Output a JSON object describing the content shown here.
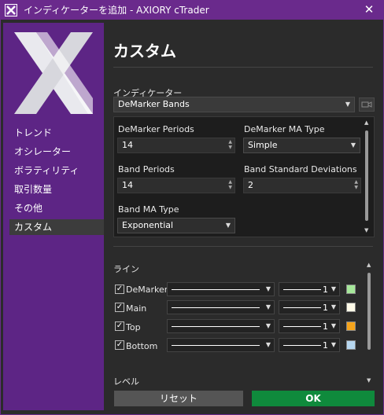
{
  "window": {
    "title": "インディケーターを追加 - AXIORY cTrader",
    "accent": "#5d2585"
  },
  "sidebar": {
    "items": [
      {
        "label": "トレンド",
        "active": false
      },
      {
        "label": "オシレーター",
        "active": false
      },
      {
        "label": "ボラティリティ",
        "active": false
      },
      {
        "label": "取引数量",
        "active": false
      },
      {
        "label": "その他",
        "active": false
      },
      {
        "label": "カスタム",
        "active": true
      }
    ]
  },
  "main": {
    "heading": "カスタム",
    "indicator_label": "インディケーター",
    "indicator_value": "DeMarker Bands",
    "params": {
      "demarker_periods": {
        "label": "DeMarker Periods",
        "value": "14"
      },
      "demarker_ma_type": {
        "label": "DeMarker MA Type",
        "value": "Simple"
      },
      "band_periods": {
        "label": "Band Periods",
        "value": "14"
      },
      "band_std_dev": {
        "label": "Band Standard Deviations",
        "value": "2"
      },
      "band_ma_type": {
        "label": "Band MA Type",
        "value": "Exponential"
      }
    },
    "lines_label": "ライン",
    "lines": [
      {
        "name": "DeMarker",
        "checked": true,
        "thickness": "1",
        "color": "#a6e89a"
      },
      {
        "name": "Main",
        "checked": true,
        "thickness": "1",
        "color": "#fffbe8"
      },
      {
        "name": "Top",
        "checked": true,
        "thickness": "1",
        "color": "#f5a41c"
      },
      {
        "name": "Bottom",
        "checked": true,
        "thickness": "1",
        "color": "#b7d7ef"
      }
    ],
    "levels_label": "レベル"
  },
  "footer": {
    "reset_label": "リセット",
    "ok_label": "OK",
    "ok_color": "#0f8a3c"
  }
}
